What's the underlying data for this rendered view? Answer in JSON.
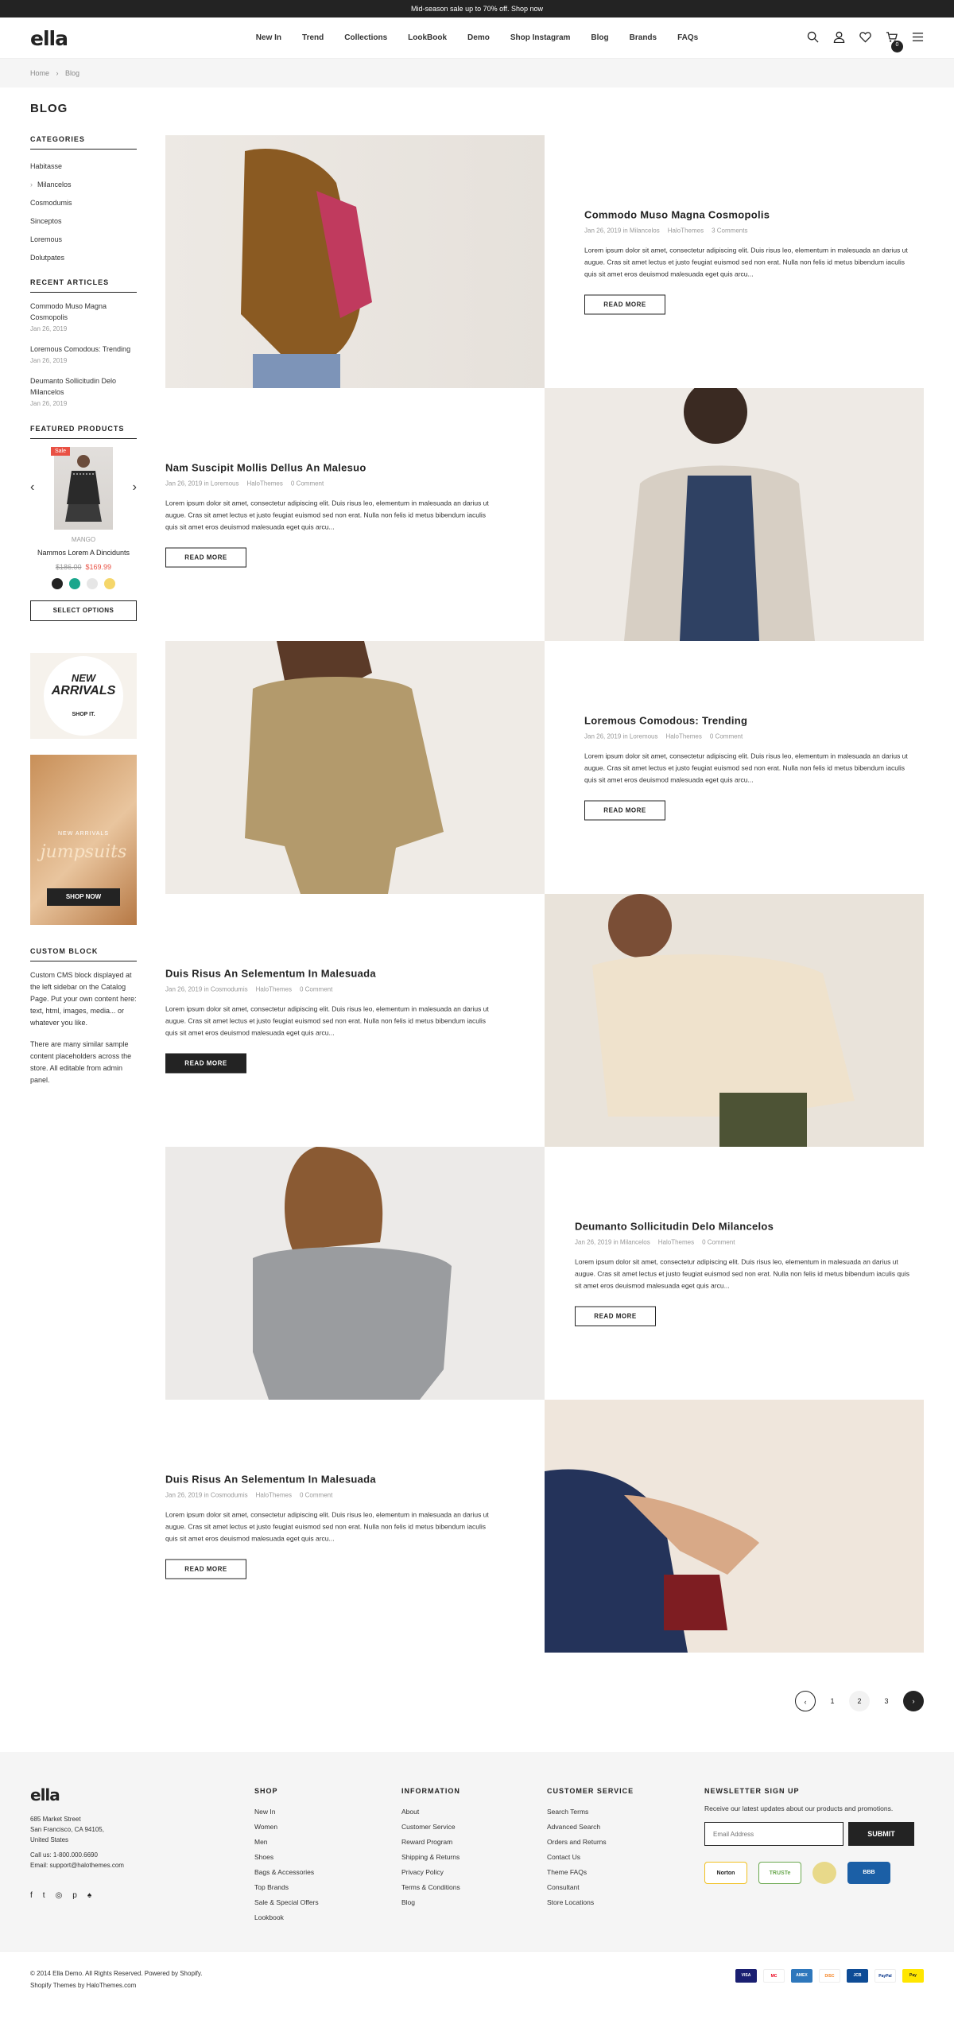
{
  "topbar": {
    "text": "Mid-season sale up to 70% off. Shop now"
  },
  "header": {
    "logo": "ella",
    "nav": [
      "New In",
      "Trend",
      "Collections",
      "LookBook",
      "Demo",
      "Shop Instagram",
      "Blog",
      "Brands",
      "FAQs"
    ],
    "cart_count": "0"
  },
  "breadcrumb": {
    "home": "Home",
    "sep": "›",
    "current": "Blog"
  },
  "sidebar": {
    "title": "BLOG",
    "categories_title": "CATEGORIES",
    "categories": [
      "Habitasse",
      "Milancelos",
      "Cosmodumis",
      "Sinceptos",
      "Loremous",
      "Dolutpates"
    ],
    "recent_title": "RECENT ARTICLES",
    "recent": [
      {
        "title": "Commodo Muso Magna Cosmopolis",
        "date": "Jan 26, 2019"
      },
      {
        "title": "Loremous Comodous: Trending",
        "date": "Jan 26, 2019"
      },
      {
        "title": "Deumanto Sollicitudin Delo Milancelos",
        "date": "Jan 26, 2019"
      }
    ],
    "featured_title": "FEATURED PRODUCTS",
    "product": {
      "sale": "Sale",
      "brand": "MANGO",
      "name": "Nammos Lorem A Dincidunts",
      "old_price": "$186.00",
      "new_price": "$169.99",
      "button": "SELECT OPTIONS",
      "swatches": [
        "#232323",
        "#1aa68c",
        "#e6e6e6",
        "#f5d66a"
      ]
    },
    "banner1": {
      "line1": "NEW",
      "line2": "ARRIVALS",
      "cta": "SHOP IT."
    },
    "banner2": {
      "line1": "NEW ARRIVALS",
      "line2": "jumpsuits",
      "cta": "SHOP NOW"
    },
    "custom_title": "CUSTOM BLOCK",
    "custom_p1": "Custom CMS block displayed at the left sidebar on the Catalog Page. Put your own content here: text, html, images, media... or whatever you like.",
    "custom_p2": "There are many similar sample content placeholders across the store. All editable from admin panel."
  },
  "posts": [
    {
      "title": "Commodo Muso Magna Cosmopolis",
      "date": "Jan 26, 2019 in Milancelos",
      "author": "HaloThemes",
      "comments": "3 Comments",
      "excerpt": "Lorem ipsum dolor sit amet, consectetur adipiscing elit. Duis risus leo, elementum in malesuada an darius ut augue. Cras sit amet lectus et justo feugiat euismod sed non erat. Nulla non felis id metus bibendum iaculis quis sit amet eros deuismod malesuada eget quis arcu...",
      "button": "READ MORE"
    },
    {
      "title": "Nam Suscipit Mollis Dellus An Malesuo",
      "date": "Jan 26, 2019 in Loremous",
      "author": "HaloThemes",
      "comments": "0 Comment",
      "excerpt": "Lorem ipsum dolor sit amet, consectetur adipiscing elit. Duis risus leo, elementum in malesuada an darius ut augue. Cras sit amet lectus et justo feugiat euismod sed non erat. Nulla non felis id metus bibendum iaculis quis sit amet eros deuismod malesuada eget quis arcu...",
      "button": "READ MORE"
    },
    {
      "title": "Loremous Comodous: Trending",
      "date": "Jan 26, 2019 in Loremous",
      "author": "HaloThemes",
      "comments": "0 Comment",
      "excerpt": "Lorem ipsum dolor sit amet, consectetur adipiscing elit. Duis risus leo, elementum in malesuada an darius ut augue. Cras sit amet lectus et justo feugiat euismod sed non erat. Nulla non felis id metus bibendum iaculis quis sit amet eros deuismod malesuada eget quis arcu...",
      "button": "READ MORE"
    },
    {
      "title": "Duis Risus An Selementum In Malesuada",
      "date": "Jan 26, 2019 in Cosmodumis",
      "author": "HaloThemes",
      "comments": "0 Comment",
      "excerpt": "Lorem ipsum dolor sit amet, consectetur adipiscing elit. Duis risus leo, elementum in malesuada an darius ut augue. Cras sit amet lectus et justo feugiat euismod sed non erat. Nulla non felis id metus bibendum iaculis quis sit amet eros deuismod malesuada eget quis arcu...",
      "button": "READ MORE"
    },
    {
      "title": "Deumanto Sollicitudin Delo Milancelos",
      "date": "Jan 26, 2019 in Milancelos",
      "author": "HaloThemes",
      "comments": "0 Comment",
      "excerpt": "Lorem ipsum dolor sit amet, consectetur adipiscing elit. Duis risus leo, elementum in malesuada an darius ut augue. Cras sit amet lectus et justo feugiat euismod sed non erat. Nulla non felis id metus bibendum iaculis quis sit amet eros deuismod malesuada eget quis arcu...",
      "button": "READ MORE"
    },
    {
      "title": "Duis Risus An Selementum In Malesuada",
      "date": "Jan 26, 2019 in Cosmodumis",
      "author": "HaloThemes",
      "comments": "0 Comment",
      "excerpt": "Lorem ipsum dolor sit amet, consectetur adipiscing elit. Duis risus leo, elementum in malesuada an darius ut augue. Cras sit amet lectus et justo feugiat euismod sed non erat. Nulla non felis id metus bibendum iaculis quis sit amet eros deuismod malesuada eget quis arcu...",
      "button": "READ MORE"
    }
  ],
  "pagination": {
    "pages": [
      "1",
      "2",
      "3"
    ]
  },
  "footer": {
    "logo": "ella",
    "address": [
      "685 Market Street",
      "San Francisco, CA 94105,",
      "United States"
    ],
    "call": "Call us: 1-800.000.6690",
    "email": "Email: support@halothemes.com",
    "shop_title": "SHOP",
    "shop": [
      "New In",
      "Women",
      "Men",
      "Shoes",
      "Bags & Accessories",
      "Top Brands",
      "Sale & Special Offers",
      "Lookbook"
    ],
    "info_title": "INFORMATION",
    "info": [
      "About",
      "Customer Service",
      "Reward Program",
      "Shipping & Returns",
      "Privacy Policy",
      "Terms & Conditions",
      "Blog"
    ],
    "cs_title": "CUSTOMER SERVICE",
    "cs": [
      "Search Terms",
      "Advanced Search",
      "Orders and Returns",
      "Contact Us",
      "Theme FAQs",
      "Consultant",
      "Store Locations"
    ],
    "nl_title": "NEWSLETTER SIGN UP",
    "nl_text": "Receive our latest updates about our products and promotions.",
    "nl_placeholder": "Email Address",
    "nl_button": "SUBMIT",
    "trust": [
      "Norton",
      "TRUSTe",
      "",
      "BBB"
    ],
    "copyright1": "© 2014 Ella Demo. All Rights Reserved. Powered by Shopify.",
    "copyright2": "Shopify Themes by HaloThemes.com",
    "payments": [
      "VISA",
      "MC",
      "AMEX",
      "DISC",
      "JCB",
      "PayPal",
      "Pay"
    ]
  }
}
